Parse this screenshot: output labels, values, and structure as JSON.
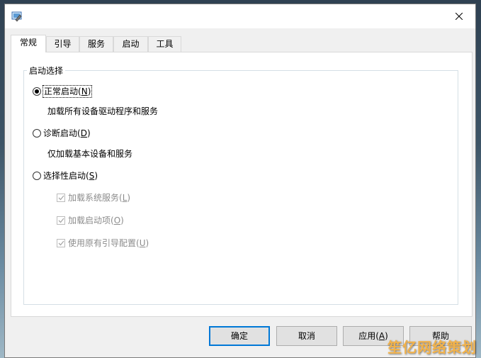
{
  "tabs": [
    {
      "label": "常规",
      "active": true
    },
    {
      "label": "引导",
      "active": false
    },
    {
      "label": "服务",
      "active": false
    },
    {
      "label": "启动",
      "active": false
    },
    {
      "label": "工具",
      "active": false
    }
  ],
  "group_title": "启动选择",
  "options": {
    "normal": {
      "label": "正常启动",
      "accel": "N",
      "desc": "加载所有设备驱动程序和服务",
      "checked": true
    },
    "diagnostic": {
      "label": "诊断启动",
      "accel": "D",
      "desc": "仅加载基本设备和服务",
      "checked": false
    },
    "selective": {
      "label": "选择性启动",
      "accel": "S",
      "checked": false
    }
  },
  "sub_options": [
    {
      "label": "加载系统服务",
      "accel": "L",
      "checked": true,
      "enabled": false
    },
    {
      "label": "加载启动项",
      "accel": "O",
      "checked": true,
      "enabled": false
    },
    {
      "label": "使用原有引导配置",
      "accel": "U",
      "checked": true,
      "enabled": false
    }
  ],
  "buttons": {
    "ok": "确定",
    "cancel": "取消",
    "apply": "应用",
    "apply_accel": "A",
    "help": "帮助"
  },
  "watermark": "笙亿网络策划",
  "colors": {
    "accent": "#0078d7",
    "disabled_text": "#8c8c8c"
  }
}
